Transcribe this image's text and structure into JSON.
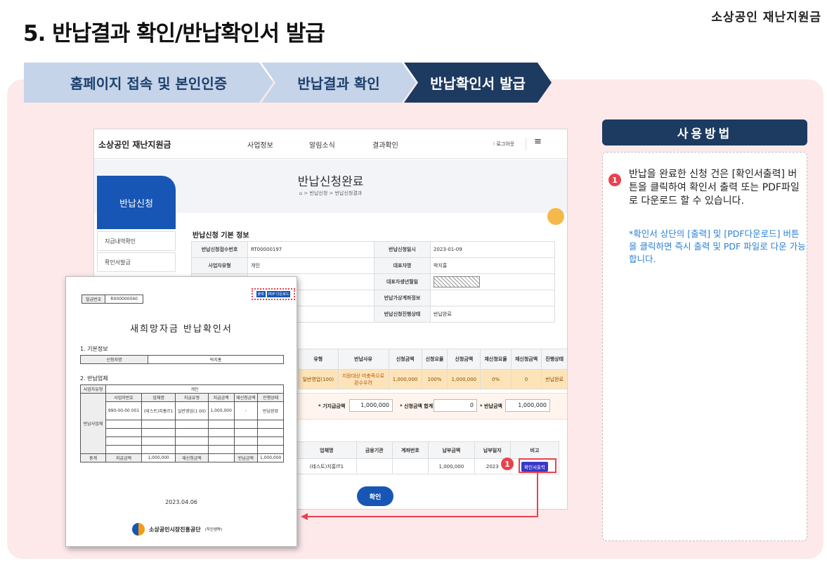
{
  "brand": "소상공인 재난지원금",
  "title": "5. 반납결과 확인/반납확인서 발급",
  "steps": [
    "홈페이지 접속 및 본인인증",
    "반납결과 확인",
    "반납확인서 발급"
  ],
  "how_to": {
    "title": "사용방법",
    "badge": "1",
    "text": "반납을 완료한 신청 건은 [확인서출력] 버튼을 클릭하여 확인서 출력 또는 PDF파일로 다운로드 할 수 있습니다.",
    "note": "*확인서 상단의 [출력] 및 [PDF다운로드] 버튼을 클릭하면 즉시 출력 및 PDF 파일로  다운 가능합니다."
  },
  "web": {
    "logo": "소상공인 재난지원금",
    "nav": [
      "사업정보",
      "알림소식",
      "결과확인"
    ],
    "logout": "로그아웃",
    "menu_icon": "hamburger-icon",
    "side_hero": "반납신청",
    "side_items": [
      "지급내역확인",
      "확인서발급"
    ],
    "page_title": "반납신청완료",
    "breadcrumb": "⌂ > 반납신청 > 반납신청결과",
    "section_title": "반납신청 기본 정보",
    "basic": [
      {
        "l1": "반납신청접수번호",
        "v1": "RT00000197",
        "l2": "반납신청일시",
        "v2": "2023-01-09"
      },
      {
        "l1": "사업자유형",
        "v1": "개인",
        "l2": "대표자명",
        "v2": "박지홍"
      },
      {
        "l1": "",
        "v1": "",
        "l2": "대표자생년월일",
        "v2": ""
      },
      {
        "l1": "",
        "v1": "",
        "l2": "반납가상계좌정보",
        "v2": ""
      },
      {
        "l1": "",
        "v1": "",
        "l2": "반납신청진행상태",
        "v2": "반납완료"
      }
    ],
    "return_headers": [
      "유형",
      "반납사유",
      "신청금액",
      "신청요율",
      "신청금액",
      "재신청요율",
      "재신청금액",
      "진행상태"
    ],
    "return_row": [
      "일반영업(100)",
      "지원대상 미충족으로 환수우려",
      "1,000,000",
      "100%",
      "1,000,000",
      "0%",
      "0",
      "반납완료"
    ],
    "sum": {
      "label1": "* 기지급금액",
      "value1": "1,000,000",
      "label2": "* 신청금액 합계",
      "value2": "0",
      "label3": "* 반납금액",
      "value3": "1,000,000"
    },
    "pay_headers": [
      "업체명",
      "금융기관",
      "계좌번호",
      "납부금액",
      "납부일자",
      "비고"
    ],
    "pay_row": [
      "(테스트)지홍IT1",
      "",
      "",
      "1,000,000",
      "2023",
      "확인서출력"
    ],
    "confirm": "확인",
    "badge": "1"
  },
  "cert": {
    "issue_no_label": "발급번호",
    "issue_no": "R000000040",
    "print_btn": "출력",
    "pdf_btn": "PDF 다운로드",
    "title": "새희망자금 반납확인서",
    "sec1": "1. 기본정보",
    "applicant_label": "신청자명",
    "applicant": "박지홍",
    "sec2": "2. 반납업체",
    "biz_type_label": "사업자유형",
    "biz_type": "개인",
    "biz_block_label": "반납사업체",
    "biz_headers": [
      "사업자번호",
      "업체명",
      "지급유형",
      "지급금액",
      "재신청금액",
      "진행상태"
    ],
    "biz_row": [
      "990-00-00 001",
      "(테스트)지홍IT1",
      "일반영업(1 00)",
      "1,000,000",
      "-",
      "반납완료"
    ],
    "total_label": "총계",
    "total_paid_label": "지급금액",
    "total_paid": "1,000,000",
    "total_reapply_label": "재신청금액",
    "total_return_label": "반납금액",
    "total_return": "1,000,000",
    "date": "2023.04.06",
    "org": "소상공인시장진흥공단",
    "org_sub": "(직인생략)"
  },
  "colors": {
    "accent_navy": "#1d3a60",
    "accent_red": "#e8424f",
    "panel_pink": "#fde9ea",
    "brand_blue": "#1756b5"
  }
}
